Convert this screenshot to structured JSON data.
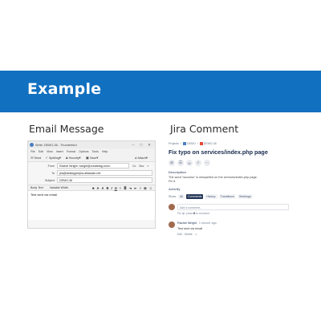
{
  "banner": {
    "title": "Example"
  },
  "sections": {
    "left_title": "Email Message",
    "right_title": "Jira Comment"
  },
  "thunderbird": {
    "window_title": "Write: DEMO-36 - Thunderbird",
    "window_buttons": {
      "minimize": "–",
      "maximize": "□",
      "close": "✕"
    },
    "menu": [
      "File",
      "Edit",
      "View",
      "Insert",
      "Format",
      "Options",
      "Tools",
      "Help"
    ],
    "toolbar": {
      "send": "Send",
      "spelling": "Spelling",
      "security": "Security",
      "save": "Save",
      "attach": "Attach"
    },
    "fields": {
      "from_label": "From",
      "from_value": "Rachel Wright <wright@createtag.com>",
      "cc": "Cc",
      "bcc": "Bcc",
      "to_label": "To",
      "to_value": "jira@strategyforjira.atlassian.net",
      "subject_label": "Subject",
      "subject_value": "DEMO-36"
    },
    "format_bar": {
      "paragraph": "Body Text",
      "font": "Variable Width"
    },
    "body": "Test sent via email"
  },
  "jira": {
    "breadcrumb": {
      "projects": "Projects",
      "project": "DEMO",
      "issue": "DEMO-36"
    },
    "title": "Fix typo on services/index.php page",
    "action_icons": [
      "attachment-icon",
      "checklist-icon",
      "link-icon",
      "check-icon",
      "more-icon"
    ],
    "description_heading": "Description",
    "description": "The word \"success\" is misspelled on the services/index.php page.",
    "description_line2": "Fix it.",
    "activity_heading": "Activity",
    "show_label": "Show:",
    "tabs": [
      "All",
      "Comments",
      "History",
      "Transitions",
      "Worklogs"
    ],
    "active_tab": "Comments",
    "add_comment_placeholder": "Add a comment...",
    "pro_tip": {
      "prefix": "Pro tip: press",
      "key": "M",
      "suffix": "to comment"
    },
    "comment": {
      "author": "Rachel Wright",
      "time": "1 minute ago",
      "text": "Test sent via email",
      "actions": "Edit  ·  Delete  ·  ☺"
    }
  }
}
